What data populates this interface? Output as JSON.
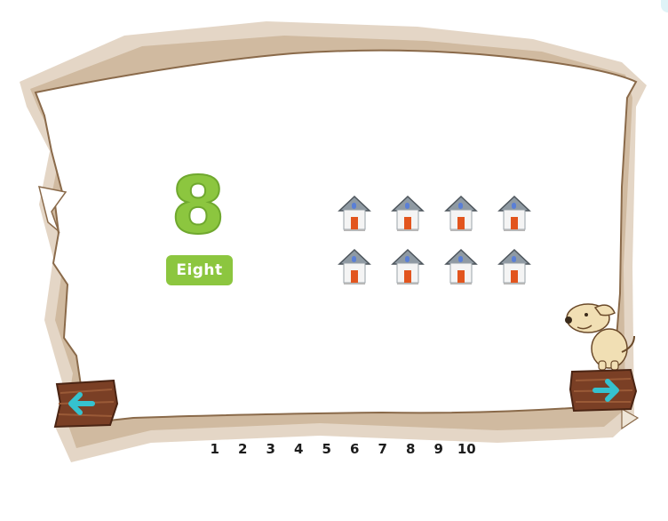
{
  "lesson": {
    "numeral": "8",
    "word": "Eight",
    "object_icon": "house-icon",
    "object_count": 8
  },
  "navigation": {
    "prev_icon": "left-arrow-icon",
    "next_icon": "right-arrow-icon",
    "pages": [
      "1",
      "2",
      "3",
      "4",
      "5",
      "6",
      "7",
      "8",
      "9",
      "10"
    ]
  },
  "mascot": {
    "icon": "dog-icon"
  },
  "colors": {
    "accent_green": "#8cc63f",
    "arrow_cyan": "#35c2cf",
    "wood": "#7a3f25",
    "parchment_edge": "#8a6a4a"
  }
}
